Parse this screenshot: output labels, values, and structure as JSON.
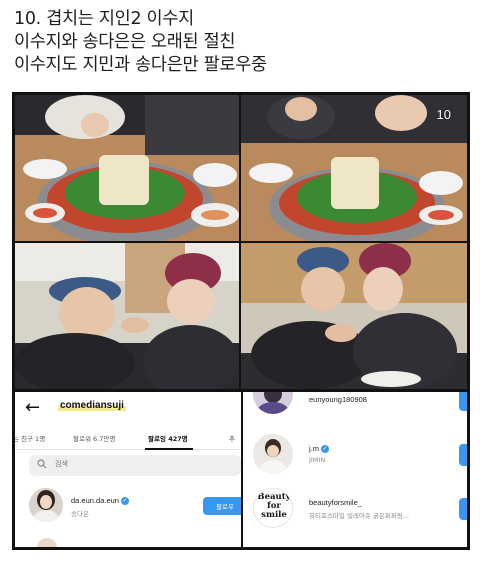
{
  "caption": {
    "line1": "10. 겹치는 지인2 이수지",
    "line2": "이수지와 송다은은 오래된 절친",
    "line3": "이수지도 지민과 송다은만 팔로우중"
  },
  "photo_count": "10",
  "profile": {
    "back_icon": "back-arrow-icon",
    "username": "comediansuji",
    "tabs": [
      {
        "label": "아는 친구 1명"
      },
      {
        "label": "팔로워 6.7만명"
      },
      {
        "label": "팔로잉 427명"
      },
      {
        "label": "추"
      }
    ],
    "search_placeholder": "검색",
    "following": [
      {
        "handle": "da.eun.da.eun",
        "name": "송다은",
        "verified": true,
        "button": "팔로우"
      }
    ]
  },
  "jimin_following": [
    {
      "handle": "eunyoung180908",
      "name": ""
    },
    {
      "handle": "j.m",
      "name": "JIMIN",
      "verified": true
    },
    {
      "handle": "beautyforsmile_",
      "name": "뷰티포스마일 빌레아쥬 굵은퍼퍼링..."
    }
  ],
  "logo_text": {
    "line1": "Beauty",
    "line2": "for",
    "line3": "smile"
  },
  "colors": {
    "accent": "#3897f0",
    "highlight": "#f6e98a",
    "frame": "#111111"
  }
}
